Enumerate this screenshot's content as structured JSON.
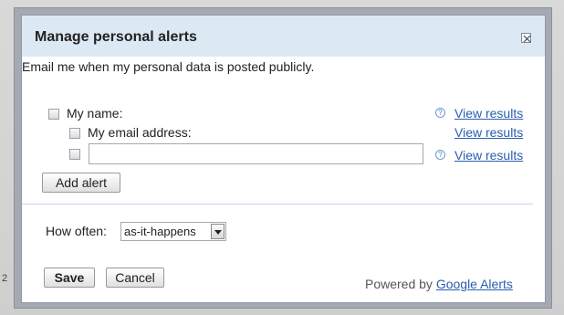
{
  "dialog": {
    "title": "Manage personal alerts",
    "intro": "Email me when my personal data is posted publicly."
  },
  "options": [
    {
      "label": "My name:",
      "link": "View results",
      "has_help": true,
      "checked": false
    },
    {
      "label": "My email address:",
      "link": "View results",
      "has_help": false,
      "checked": false
    },
    {
      "input_value": "",
      "link": "View results",
      "has_help": true,
      "checked": false
    }
  ],
  "help_icon_glyph": "?",
  "add_alert_label": "Add alert",
  "frequency": {
    "label": "How often:",
    "value": "as-it-happens"
  },
  "footer": {
    "save_label": "Save",
    "cancel_label": "Cancel",
    "powered_prefix": "Powered by",
    "powered_link": "Google Alerts"
  },
  "background_char": "2",
  "colors": {
    "title_bar": "#dde8f5",
    "link": "#2a5db0",
    "divider": "#c9d7ea"
  }
}
